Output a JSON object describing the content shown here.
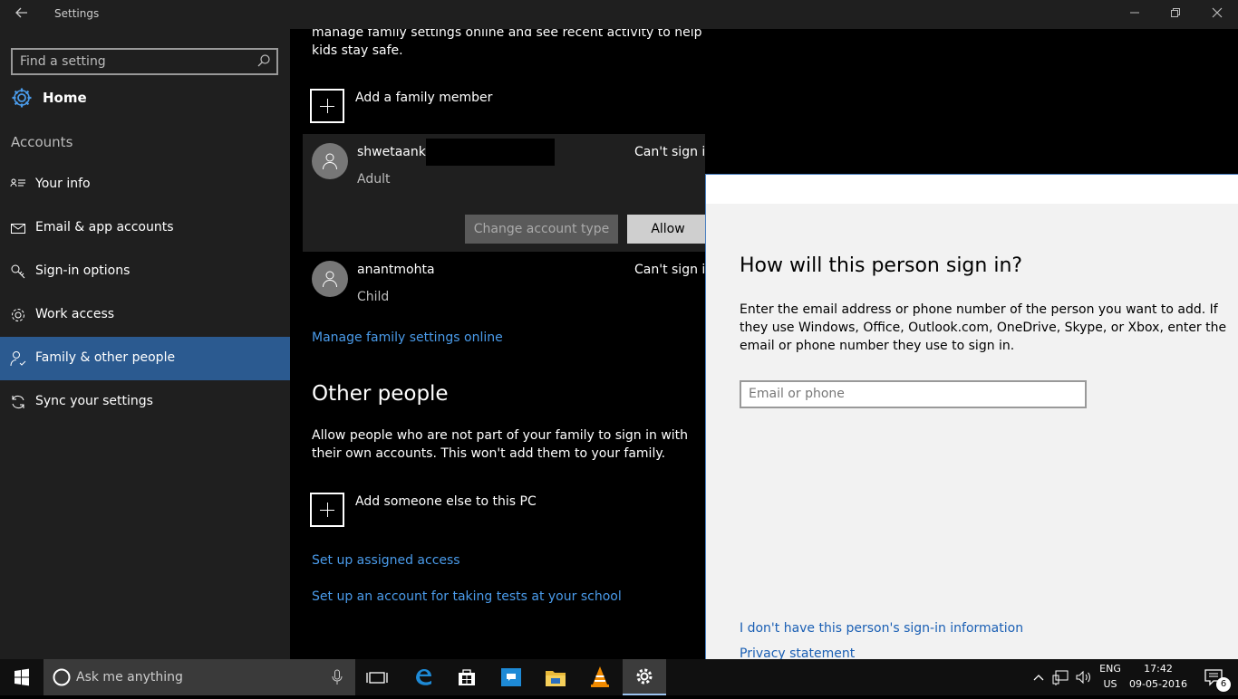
{
  "window": {
    "title": "Settings"
  },
  "sidebar": {
    "search_placeholder": "Find a setting",
    "home_label": "Home",
    "section_label": "Accounts",
    "items": [
      {
        "label": "Your info",
        "icon": "id-card-icon"
      },
      {
        "label": "Email & app accounts",
        "icon": "envelope-icon"
      },
      {
        "label": "Sign-in options",
        "icon": "key-icon"
      },
      {
        "label": "Work access",
        "icon": "briefcase-gear-icon"
      },
      {
        "label": "Family & other people",
        "icon": "person-icon",
        "selected": true
      },
      {
        "label": "Sync your settings",
        "icon": "sync-icon"
      }
    ]
  },
  "family": {
    "intro": "manage family settings online and see recent activity to help kids stay safe.",
    "add_member_label": "Add a family member",
    "members": [
      {
        "name": "shwetaanka",
        "role": "Adult",
        "status": "Can't sign in"
      },
      {
        "name": "anantmohta",
        "role": "Child",
        "status": "Can't sign in"
      }
    ],
    "change_account_type": "Change account type",
    "allow": "Allow",
    "manage_link": "Manage family settings online"
  },
  "other_people": {
    "heading": "Other people",
    "description": "Allow people who are not part of your family to sign in with their own accounts. This won't add them to your family.",
    "add_label": "Add someone else to this PC",
    "assigned_access_link": "Set up assigned access",
    "tests_link": "Set up an account for taking tests at your school"
  },
  "dialog": {
    "title": "How will this person sign in?",
    "text": "Enter the email address or phone number of the person you want to add. If they use Windows, Office, Outlook.com, OneDrive, Skype, or Xbox, enter the email or phone number they use to sign in.",
    "input_placeholder": "Email or phone",
    "no_info_link": "I don't have this person's sign-in information",
    "privacy_link": "Privacy statement"
  },
  "taskbar": {
    "search_placeholder": "Ask me anything",
    "language": "ENG",
    "region": "US",
    "time": "17:42",
    "date": "09-05-2016",
    "notification_count": "6"
  },
  "colors": {
    "accent": "#2b5a90",
    "link_dark": "#4a9bea",
    "link_light": "#1a5fb4"
  }
}
